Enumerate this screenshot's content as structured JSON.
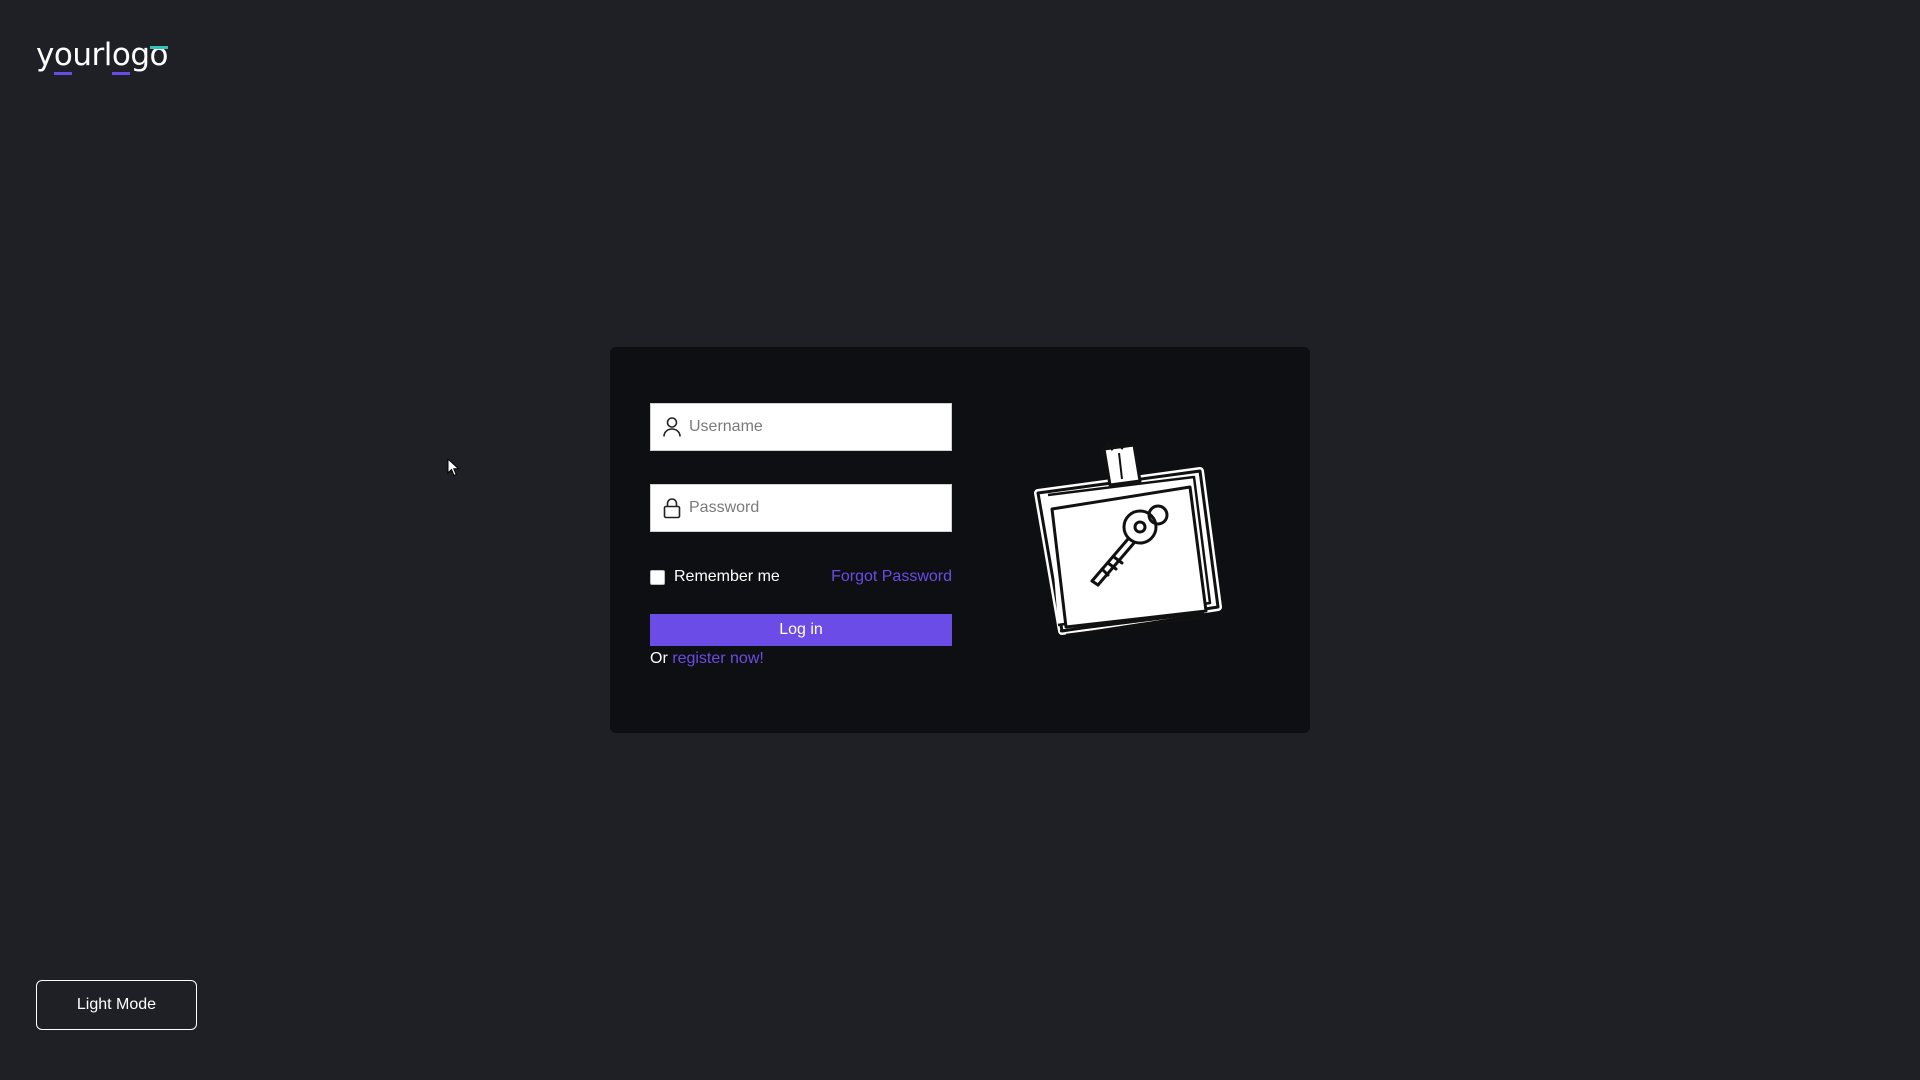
{
  "logo": {
    "text_parts": [
      "y",
      "o",
      "u",
      "r",
      "l",
      "o",
      "g",
      "o"
    ]
  },
  "login_form": {
    "username_placeholder": "Username",
    "password_placeholder": "Password",
    "remember_label": "Remember me",
    "remember_checked": false,
    "forgot_label": "Forgot Password",
    "login_label": "Log in",
    "register_prefix": "Or",
    "register_link": "register now!"
  },
  "theme_toggle": {
    "label": "Light Mode"
  },
  "icons": {
    "username": "user-icon",
    "password": "lock-icon",
    "illustration": "sticky-note-key-illustration"
  },
  "colors": {
    "background": "#1f2025",
    "card": "#0e0f12",
    "accent": "#6b4ce6",
    "logo_accent": "#2ec4b6"
  }
}
